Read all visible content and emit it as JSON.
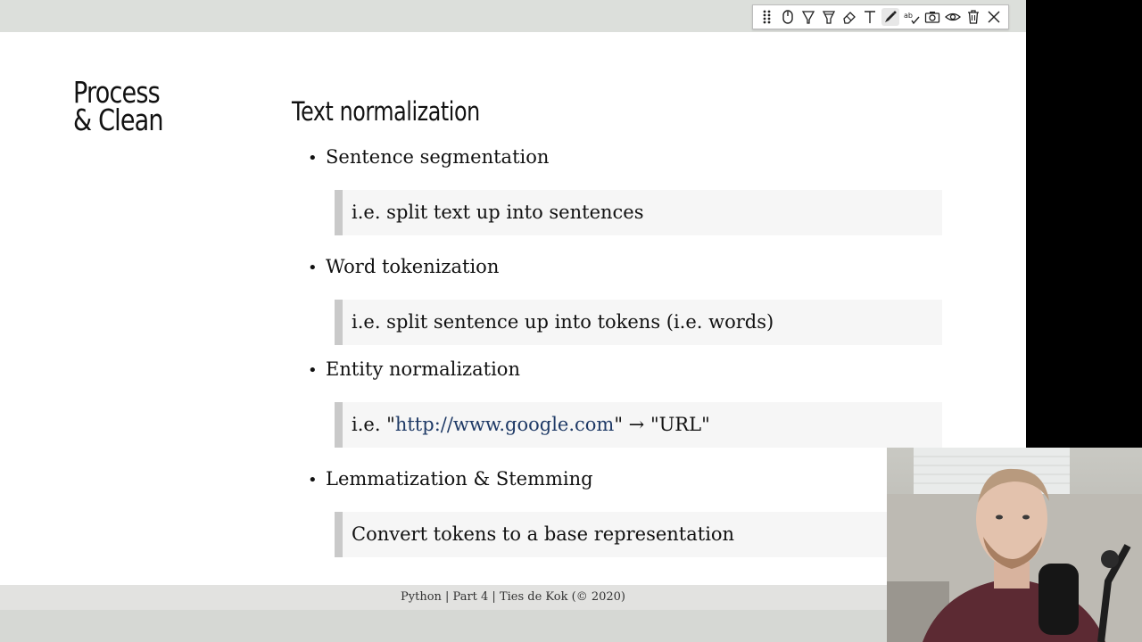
{
  "section_title_line1": "Process",
  "section_title_line2": "& Clean",
  "heading": "Text normalization",
  "bullets": [
    {
      "label": "Sentence segmentation",
      "quote": "i.e. split text up into sentences"
    },
    {
      "label": "Word tokenization",
      "quote": "i.e. split sentence up into tokens (i.e. words)"
    },
    {
      "label": "Entity normalization",
      "quote_prefix": "i.e. \"",
      "quote_link": "http://www.google.com",
      "quote_suffix": "\" → \"URL\""
    },
    {
      "label": "Lemmatization & Stemming",
      "quote": "Convert tokens to a base representation"
    }
  ],
  "footer": "Python | Part 4 | Ties de Kok (© 2020)",
  "toolbar": {
    "icons": [
      "drag-handle-icon",
      "mouse-icon",
      "highlighter-icon",
      "marker-icon",
      "eraser-icon",
      "text-icon",
      "pen-icon",
      "spellcheck-icon",
      "camera-icon",
      "eye-icon",
      "trash-icon",
      "close-icon"
    ],
    "active": "pen-icon"
  },
  "colors": {
    "link": "#1f3a66",
    "quote_bar": "#c9c9c9",
    "quote_bg": "#f6f6f6"
  }
}
